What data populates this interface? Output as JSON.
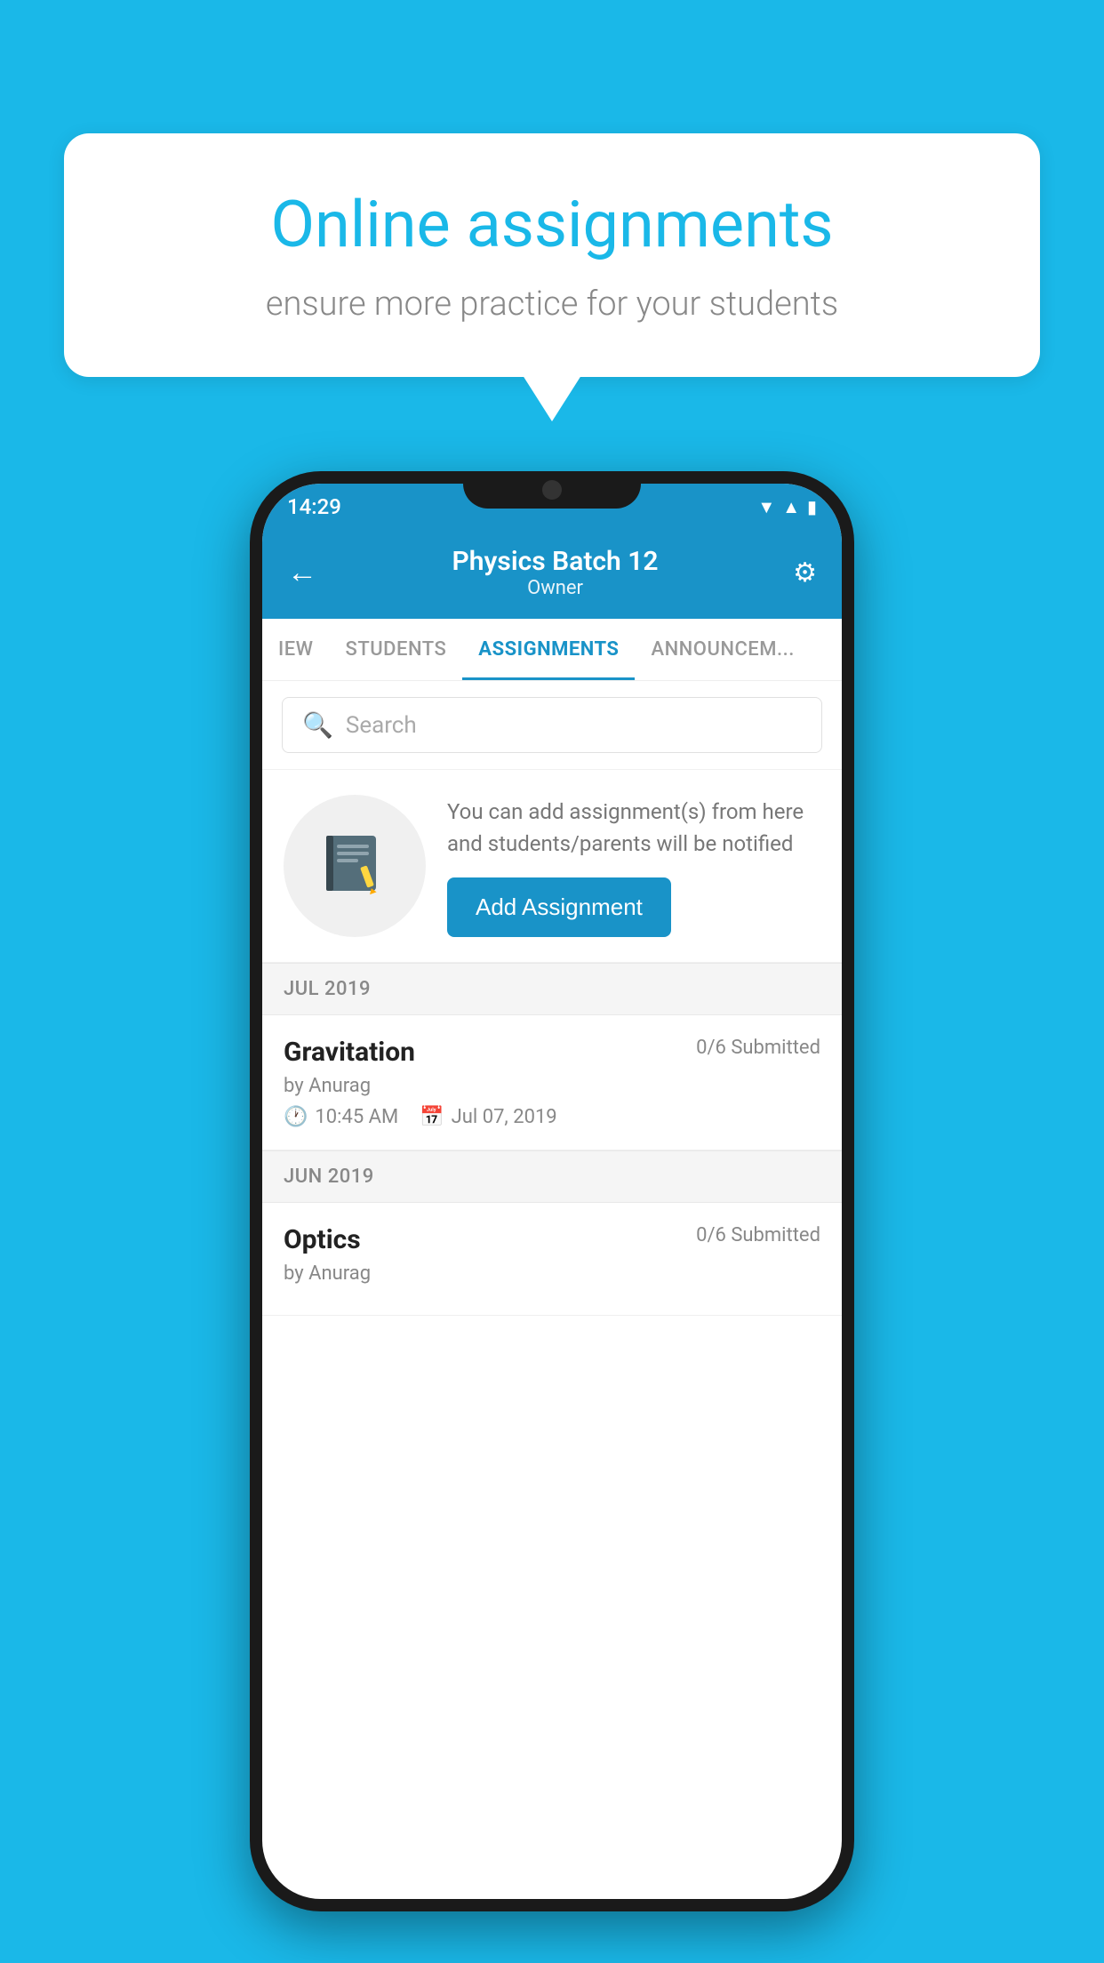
{
  "background_color": "#1ab8e8",
  "speech_bubble": {
    "title": "Online assignments",
    "subtitle": "ensure more practice for your students"
  },
  "status_bar": {
    "time": "14:29",
    "icons": [
      "wifi",
      "signal",
      "battery"
    ]
  },
  "app_header": {
    "title": "Physics Batch 12",
    "subtitle": "Owner",
    "back_label": "←",
    "settings_label": "⚙"
  },
  "tabs": [
    {
      "label": "IEW",
      "active": false
    },
    {
      "label": "STUDENTS",
      "active": false
    },
    {
      "label": "ASSIGNMENTS",
      "active": true
    },
    {
      "label": "ANNOUNCEM...",
      "active": false
    }
  ],
  "search": {
    "placeholder": "Search"
  },
  "promo": {
    "text": "You can add assignment(s) from here and students/parents will be notified",
    "button_label": "Add Assignment"
  },
  "sections": [
    {
      "header": "JUL 2019",
      "assignments": [
        {
          "title": "Gravitation",
          "submitted": "0/6 Submitted",
          "author": "by Anurag",
          "time": "10:45 AM",
          "date": "Jul 07, 2019"
        }
      ]
    },
    {
      "header": "JUN 2019",
      "assignments": [
        {
          "title": "Optics",
          "submitted": "0/6 Submitted",
          "author": "by Anurag",
          "time": "",
          "date": ""
        }
      ]
    }
  ]
}
